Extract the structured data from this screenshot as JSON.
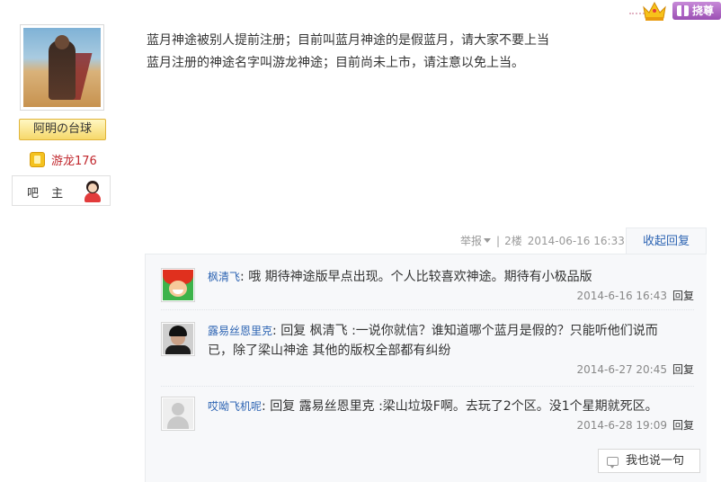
{
  "header": {
    "vip_label": "挠尊"
  },
  "author": {
    "name": "阿明の台球",
    "level_label": "游龙176",
    "role_label": "吧 主"
  },
  "post": {
    "lines": [
      "蓝月神途被别人提前注册；目前叫蓝月神途的是假蓝月，请大家不要上当",
      "蓝月注册的神途名字叫游龙神途；目前尚未上市，请注意以免上当。"
    ],
    "report_label": "举报",
    "floor": "2楼",
    "timestamp": "2014-06-16 16:33",
    "collapse_label": "收起回复"
  },
  "replies": [
    {
      "user": "枫清飞",
      "separator": ": ",
      "lines": [
        "哦 期待神途版早点出现。个人比较喜欢神途。期待有小极品版"
      ],
      "time": "2014-6-16 16:43",
      "reply_label": "回复"
    },
    {
      "user": "露易丝恩里克",
      "separator": ": ",
      "lines": [
        "回复 枫清飞 :一说你就信？谁知道哪个蓝月是假的？只能听他们说而",
        "已，除了梁山神途 其他的版权全部都有纠纷"
      ],
      "time": "2014-6-27 20:45",
      "reply_label": "回复"
    },
    {
      "user": "哎呦飞机呢",
      "separator": ": ",
      "lines": [
        "回复 露易丝恩里克 :梁山垃圾F啊。去玩了2个区。没1个星期就死区。"
      ],
      "time": "2014-6-28 19:09",
      "reply_label": "回复"
    }
  ],
  "say_button_label": "我也说一句"
}
